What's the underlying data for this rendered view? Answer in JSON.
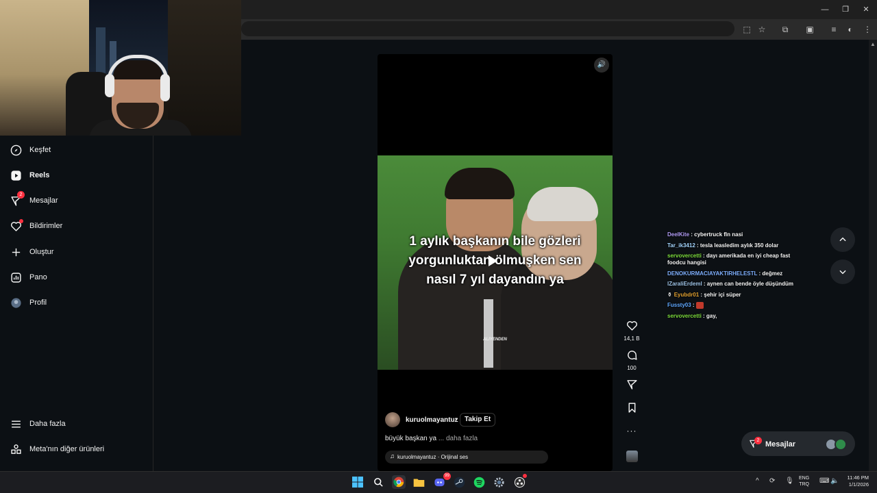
{
  "browser": {
    "window_controls": {
      "minimize": "—",
      "restore": "❐",
      "close": "✕"
    }
  },
  "sidebar": {
    "items": [
      {
        "label": "Keşfet",
        "icon": "compass-icon"
      },
      {
        "label": "Reels",
        "icon": "reels-icon",
        "active": true
      },
      {
        "label": "Mesajlar",
        "icon": "send-icon",
        "badge": "2"
      },
      {
        "label": "Bildirimler",
        "icon": "heart-icon",
        "dot": true
      },
      {
        "label": "Oluştur",
        "icon": "plus-icon"
      },
      {
        "label": "Pano",
        "icon": "dashboard-icon"
      },
      {
        "label": "Profil",
        "icon": "avatar-icon"
      }
    ],
    "more_label": "Daha fazla",
    "meta_label": "Meta'nın diğer ürünleri"
  },
  "reel": {
    "caption_overlay": [
      "1 aylık başkanın bile gözleri",
      "yorgunluktan ölmuşken sen",
      "nasıl 7 yıl dayandın ya"
    ],
    "watermark": "ALIYENDEN",
    "username": "kuruolmayantuz",
    "separator": "•",
    "follow_label": "Takip Et",
    "description": "büyük başkan ya",
    "more_link": "... daha fazla",
    "audio": "kuruolmayantuz · Orijinal ses"
  },
  "actions": {
    "likes": "14,1 B",
    "comments": "100"
  },
  "chat": [
    {
      "user": "DeelKite",
      "color": "#b19cf5",
      "text": "cybertruck fln nasi"
    },
    {
      "user": "Tar_ik3412",
      "color": "#a5d6ff",
      "text": "tesla leasledim aylık 350 dolar"
    },
    {
      "user": "servovercetti",
      "color": "#7ddc3c",
      "text": "dayı amerikada en iyi cheap fast foodcu hangisi"
    },
    {
      "user": "DENOKURMACIAYAKTIRHELESTL",
      "color": "#7fb0ff",
      "text": "değmez"
    },
    {
      "user": "lZaraliErdeml",
      "color": "#9ec3e6",
      "text": "aynen can bende öyle düşündüm"
    },
    {
      "user": "Eyubdr01",
      "color": "#e0a030",
      "text": "şehir içi süper",
      "prefix": "⚱"
    },
    {
      "user": "Fussty03",
      "color": "#5fa8ff",
      "text": "",
      "emote": true
    },
    {
      "user": "servovercetti",
      "color": "#7ddc3c",
      "text": "gay,"
    }
  ],
  "messages_pill": {
    "label": "Mesajlar",
    "badge": "2"
  },
  "taskbar": {
    "lang": [
      "ENG",
      "TRQ"
    ],
    "time": "11:46 PM",
    "date": "1/1/2026",
    "chat_badge": "99"
  }
}
